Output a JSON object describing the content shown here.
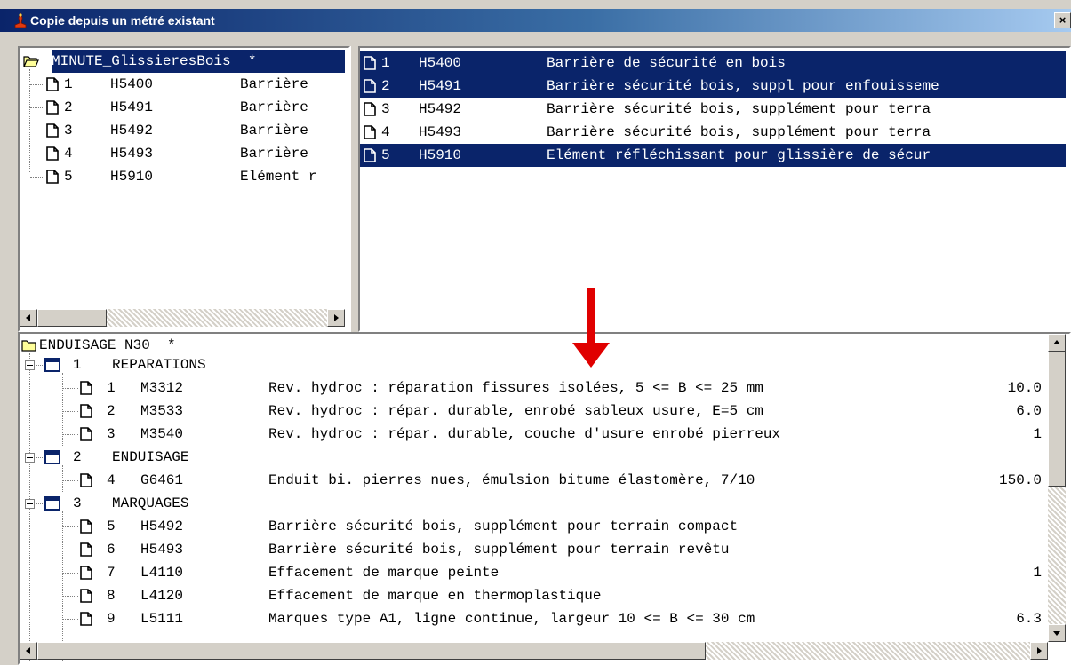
{
  "window": {
    "title": "Copie depuis un métré existant",
    "close_label": "×"
  },
  "arrow_color": "#e00000",
  "source_tree": {
    "root": "MINUTE_GlissieresBois  *",
    "items": [
      {
        "num": "1",
        "code": "H5400",
        "label": "Barrière"
      },
      {
        "num": "2",
        "code": "H5491",
        "label": "Barrière"
      },
      {
        "num": "3",
        "code": "H5492",
        "label": "Barrière"
      },
      {
        "num": "4",
        "code": "H5493",
        "label": "Barrière"
      },
      {
        "num": "5",
        "code": "H5910",
        "label": "Elément r"
      }
    ]
  },
  "source_list": {
    "rows": [
      {
        "num": "1",
        "code": "H5400",
        "desc": "Barrière de sécurité en bois",
        "selected": true
      },
      {
        "num": "2",
        "code": "H5491",
        "desc": "Barrière sécurité bois, suppl pour enfouisseme",
        "selected": true
      },
      {
        "num": "3",
        "code": "H5492",
        "desc": "Barrière sécurité bois, supplément pour terra",
        "selected": false
      },
      {
        "num": "4",
        "code": "H5493",
        "desc": "Barrière sécurité bois, supplément pour terra",
        "selected": false
      },
      {
        "num": "5",
        "code": "H5910",
        "desc": "Elément réfléchissant pour glissière de sécur",
        "selected": true
      }
    ]
  },
  "target_tree": {
    "root": "ENDUISAGE N30  *",
    "rows": [
      {
        "kind": "group",
        "num": "1",
        "label": "REPARATIONS"
      },
      {
        "kind": "item",
        "num": "1",
        "code": "M3312",
        "desc": "Rev. hydroc : réparation fissures isolées, 5 <= B <= 25 mm",
        "value": "10.0"
      },
      {
        "kind": "item",
        "num": "2",
        "code": "M3533",
        "desc": "Rev. hydroc : répar. durable, enrobé sableux usure, E=5 cm",
        "value": "6.0"
      },
      {
        "kind": "item",
        "num": "3",
        "code": "M3540",
        "desc": "Rev. hydroc : répar. durable, couche d'usure enrobé pierreux",
        "value": "1"
      },
      {
        "kind": "group",
        "num": "2",
        "label": "ENDUISAGE"
      },
      {
        "kind": "item",
        "num": "4",
        "code": "G6461",
        "desc": "Enduit bi. pierres nues, émulsion bitume élastomère, 7/10",
        "value": "150.0"
      },
      {
        "kind": "group",
        "num": "3",
        "label": "MARQUAGES"
      },
      {
        "kind": "item",
        "num": "5",
        "code": "H5492",
        "desc": "Barrière sécurité bois, supplément pour terrain compact",
        "value": ""
      },
      {
        "kind": "item",
        "num": "6",
        "code": "H5493",
        "desc": "Barrière sécurité bois, supplément pour terrain revêtu",
        "value": ""
      },
      {
        "kind": "item",
        "num": "7",
        "code": "L4110",
        "desc": "Effacement de marque peinte",
        "value": "1"
      },
      {
        "kind": "item",
        "num": "8",
        "code": "L4120",
        "desc": "Effacement de marque en thermoplastique",
        "value": ""
      },
      {
        "kind": "item",
        "num": "9",
        "code": "L5111",
        "desc": "Marques type A1, ligne continue, largeur 10 <= B <= 30 cm",
        "value": "6.3"
      }
    ]
  }
}
